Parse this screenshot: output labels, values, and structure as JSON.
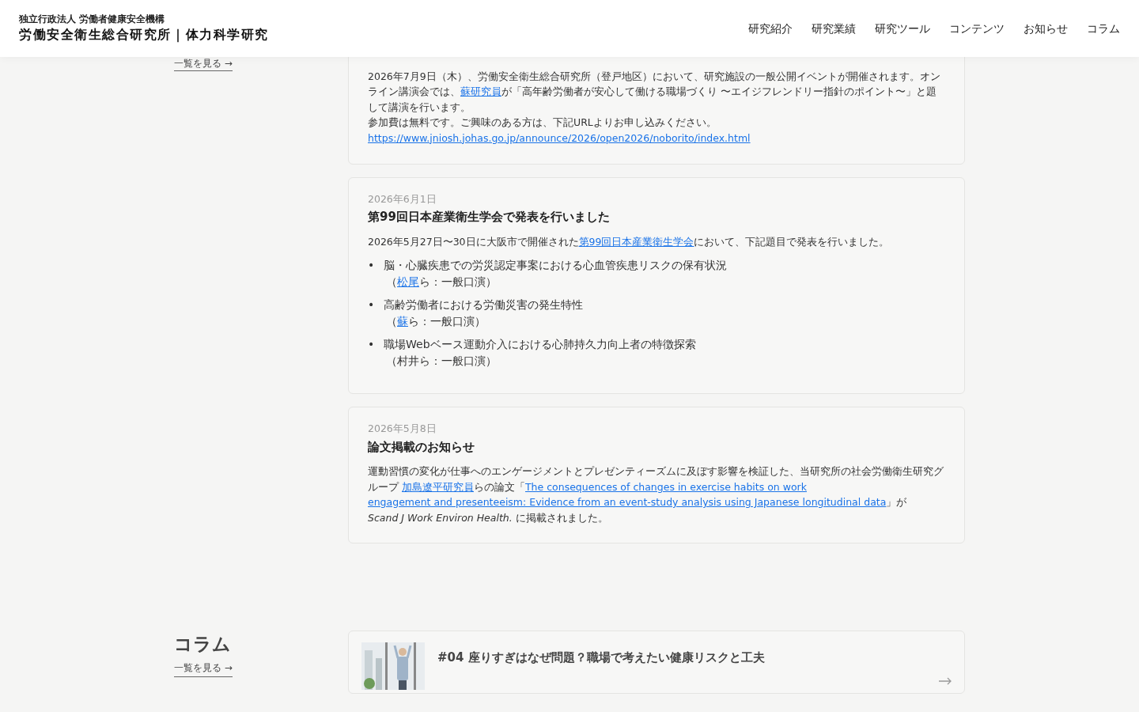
{
  "header": {
    "org": "独立行政法人 労働者健康安全機構",
    "title": "労働安全衛生総合研究所｜体力科学研究",
    "nav": [
      {
        "label": "研究紹介"
      },
      {
        "label": "研究業績"
      },
      {
        "label": "研究ツール"
      },
      {
        "label": "コンテンツ"
      },
      {
        "label": "お知らせ"
      },
      {
        "label": "コラム"
      }
    ]
  },
  "news": {
    "more_link": "一覧を見る →",
    "items": [
      {
        "body": [
          {
            "kind": "paragraph",
            "segments": [
              {
                "text": "2026年7月9日（木）、労働安全衛生総合研究所（登戸地区）において、研究施設の一般公開イベントが開催されます。オンライン講演会では、"
              },
              {
                "text": "蘇研究員",
                "link": true
              },
              {
                "text": "が「高年齢労働者が安心して働ける職場づくり 〜エイジフレンドリー指針のポイント〜」と題して講演を行います。"
              }
            ]
          },
          {
            "kind": "paragraph",
            "segments": [
              {
                "text": "参加費は無料です。ご興味のある方は、下記URLよりお申し込みください。"
              }
            ]
          },
          {
            "kind": "link",
            "text": "https://www.jniosh.johas.go.jp/announce/2026/open2026/noborito/index.html"
          }
        ]
      },
      {
        "date": "2026年6月1日",
        "title": "第99回日本産業衛生学会で発表を行いました",
        "body": [
          {
            "kind": "paragraph",
            "segments": [
              {
                "text": "2026年5月27日〜30日に大阪市で開催された"
              },
              {
                "text": "第99回日本産業衛生学会",
                "link": true
              },
              {
                "text": "において、下記題目で発表を行いました。"
              }
            ]
          },
          {
            "kind": "list",
            "items": [
              {
                "marker": "•",
                "title": "脳・心臓疾患での労災認定事案における心血管疾患リスクの保有状況",
                "note": [
                  {
                    "text": "（"
                  },
                  {
                    "text": "松尾",
                    "link": true
                  },
                  {
                    "text": "ら：一般口演）"
                  }
                ]
              },
              {
                "marker": "•",
                "title": "高齢労働者における労働災害の発生特性",
                "note": [
                  {
                    "text": "（"
                  },
                  {
                    "text": "蘇",
                    "link": true
                  },
                  {
                    "text": "ら：一般口演）"
                  }
                ]
              },
              {
                "marker": "•",
                "title": "職場Webベース運動介入における心肺持久力向上者の特徴探索",
                "note": [
                  {
                    "text": "（村井ら：一般口演）"
                  }
                ]
              }
            ]
          }
        ]
      },
      {
        "date": "2026年5月8日",
        "title": "論文掲載のお知らせ",
        "body": [
          {
            "kind": "paragraph",
            "segments": [
              {
                "text": "運動習慣の変化が仕事へのエンゲージメントとプレゼンティーズムに及ぼす影響を検証した、当研究所の社会労働衛生研究グループ "
              },
              {
                "text": "加島遼平研究員",
                "link": true
              },
              {
                "text": "らの論文「"
              },
              {
                "text": "The consequences of changes in exercise habits on work",
                "link": true
              },
              {
                "text": "engagement and presenteeism: Evidence from an event-study analysis using Japanese longitudinal data",
                "link": true
              },
              {
                "text": "」が"
              },
              {
                "text": "Scand J Work Environ Health.",
                "italic": true
              },
              {
                "text": " に掲載されました。"
              }
            ]
          }
        ]
      }
    ]
  },
  "column": {
    "heading": "コラム",
    "more_link": "一覧を見る →",
    "items": [
      {
        "title": "#04 座りすぎはなぜ問題？職場で考えたい健康リスクと工夫"
      }
    ]
  }
}
